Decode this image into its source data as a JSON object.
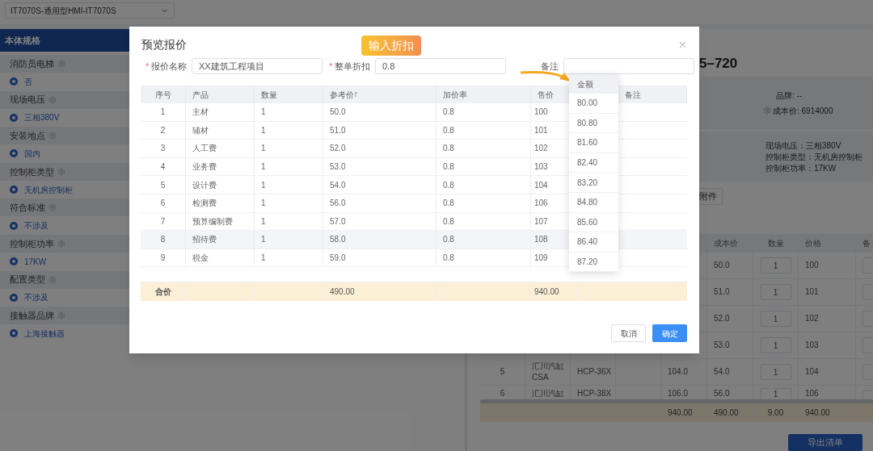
{
  "top_select": {
    "value": "IT7070S-通用型HMI-IT7070S"
  },
  "sidebar": {
    "title": "本体规格",
    "groups": [
      {
        "label": "消防员电梯",
        "option": "否",
        "selected": true
      },
      {
        "label": "现场电压",
        "option": "三相380V",
        "selected": true
      },
      {
        "label": "安装地点",
        "option": "国内",
        "selected": true
      },
      {
        "label": "控制柜类型",
        "option": "无机房控制柜",
        "selected": true
      },
      {
        "label": "符合标准",
        "option": "不涉及",
        "selected": true
      },
      {
        "label": "控制柜功率",
        "option": "17KW",
        "selected": true
      },
      {
        "label": "配置类型",
        "option": "不涉及",
        "selected": true
      },
      {
        "label": "接触器品牌",
        "option": "上海接触器",
        "selected": true
      }
    ]
  },
  "detail": {
    "title": "5–720",
    "brand": "品牌: --",
    "cost": "成本价: 6914000",
    "specs": [
      "现场电压：三相380V",
      "控制柜类型：无机房控制柜",
      "控制柜功率：17KW"
    ],
    "attach_button": "附件",
    "table": {
      "columns": [
        "成本价",
        "数量",
        "价格",
        "备"
      ],
      "rows": [
        {
          "cost": "50.0",
          "qty": "1",
          "price": "100"
        },
        {
          "cost": "51.0",
          "qty": "1",
          "price": "101"
        },
        {
          "cost": "52.0",
          "qty": "1",
          "price": "102"
        },
        {
          "cost": "53.0",
          "qty": "1",
          "price": "103"
        },
        {
          "no": "5",
          "name": "汇川汽缸",
          "name2": "CSA",
          "model": "HCP-36X",
          "total": "104.0",
          "cost": "54.0",
          "qty": "1",
          "price": "104"
        },
        {
          "no": "6",
          "name": "汇川汽缸",
          "model": "HCP-38X",
          "total": "106.0",
          "cost": "56.0",
          "qty": "1",
          "price": "106"
        }
      ],
      "totals": {
        "total": "940.00",
        "cost": "490.00",
        "qty": "9.00",
        "price": "940.00"
      }
    },
    "export_button": "导出清单"
  },
  "dialog": {
    "title": "预览报价",
    "fields": [
      {
        "label": "报价名称",
        "required": true,
        "value": "XX建筑工程项目"
      },
      {
        "label": "整单折扣",
        "required": true,
        "value": "0.8"
      },
      {
        "label": "备注",
        "required": false
      }
    ],
    "required_mark": "*",
    "tooltip": "输入折扣",
    "table": {
      "columns": [
        "序号",
        "产品",
        "数量",
        "参考价",
        "加价率",
        "售价",
        "备注"
      ],
      "rows": [
        {
          "no": "1",
          "product": "主材",
          "qty": "1",
          "ref": "50.0",
          "markup": "0.8",
          "price": "100",
          "hovered": false
        },
        {
          "no": "2",
          "product": "辅材",
          "qty": "1",
          "ref": "51.0",
          "markup": "0.8",
          "price": "101",
          "hovered": false
        },
        {
          "no": "3",
          "product": "人工费",
          "qty": "1",
          "ref": "52.0",
          "markup": "0.8",
          "price": "102",
          "hovered": false
        },
        {
          "no": "4",
          "product": "业务费",
          "qty": "1",
          "ref": "53.0",
          "markup": "0.8",
          "price": "103",
          "hovered": false
        },
        {
          "no": "5",
          "product": "设计费",
          "qty": "1",
          "ref": "54.0",
          "markup": "0.8",
          "price": "104",
          "hovered": false
        },
        {
          "no": "6",
          "product": "检测费",
          "qty": "1",
          "ref": "56.0",
          "markup": "0.8",
          "price": "106",
          "hovered": false
        },
        {
          "no": "7",
          "product": "预算编制费",
          "qty": "1",
          "ref": "57.0",
          "markup": "0.8",
          "price": "107",
          "hovered": false
        },
        {
          "no": "8",
          "product": "招待费",
          "qty": "1",
          "ref": "58.0",
          "markup": "0.8",
          "price": "108",
          "hovered": true
        },
        {
          "no": "9",
          "product": "税金",
          "qty": "1",
          "ref": "59.0",
          "markup": "0.8",
          "price": "109",
          "hovered": false
        }
      ],
      "total": {
        "label": "合价",
        "ref": "490.00",
        "price": "940.00"
      }
    },
    "amount_column": {
      "header": "金额",
      "values": [
        "80.00",
        "80.80",
        "81.60",
        "82.40",
        "83.20",
        "84.80",
        "85.60",
        "86.40",
        "87.20"
      ]
    },
    "buttons": [
      {
        "label": "取消",
        "primary": false
      },
      {
        "label": "确定",
        "primary": true
      }
    ]
  }
}
